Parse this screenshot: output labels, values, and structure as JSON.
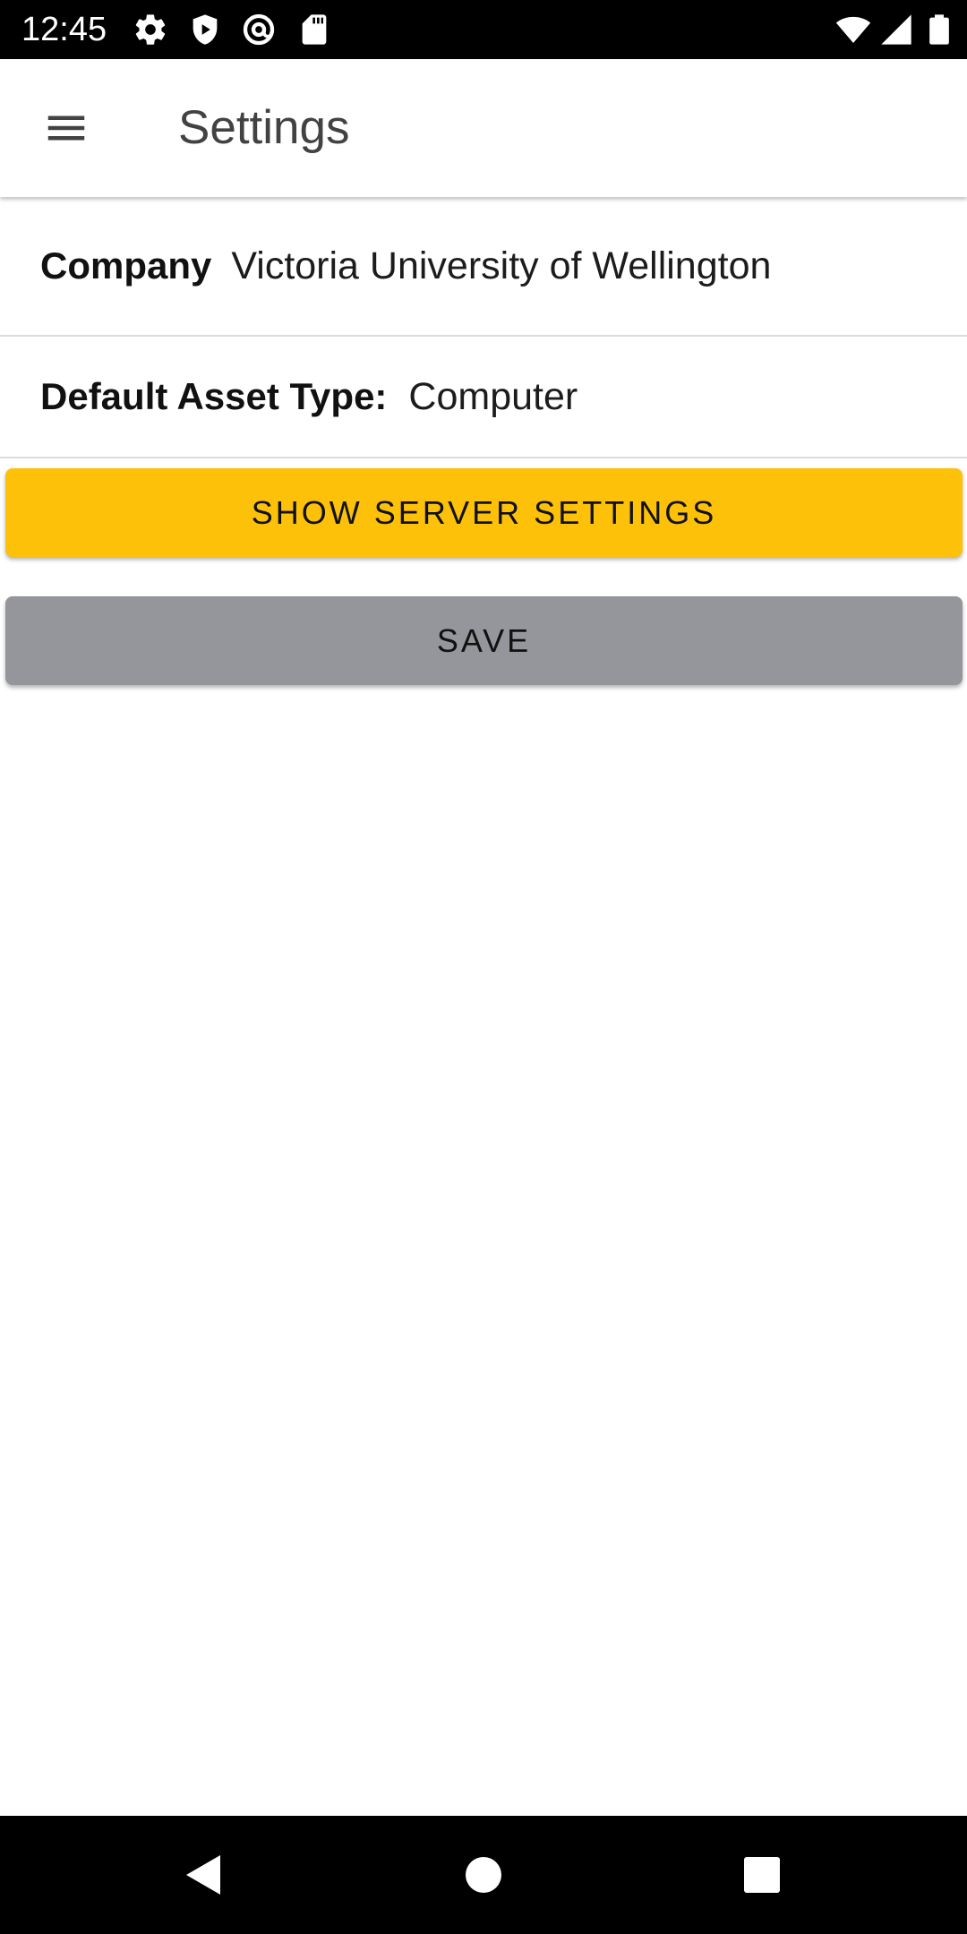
{
  "status_bar": {
    "time": "12:45",
    "left_icons": [
      "settings-icon",
      "shield-icon",
      "at-sign-icon",
      "sd-card-icon"
    ],
    "right_icons": [
      "wifi-icon",
      "signal-icon",
      "battery-icon"
    ]
  },
  "app_bar": {
    "menu_icon": "menu-icon",
    "title": "Settings"
  },
  "settings": {
    "company_label": "Company",
    "company_value": "Victoria University of Wellington",
    "asset_type_label": "Default Asset Type:",
    "asset_type_value": "Computer"
  },
  "buttons": {
    "server_settings_label": "SHOW SERVER SETTINGS",
    "save_label": "SAVE"
  },
  "nav_bar": {
    "icons": [
      "back-icon",
      "home-icon",
      "recents-icon"
    ]
  },
  "colors": {
    "accent": "#fdc10a",
    "save_button": "#94969c",
    "title_text": "#424242",
    "status_bar": "#000000"
  }
}
